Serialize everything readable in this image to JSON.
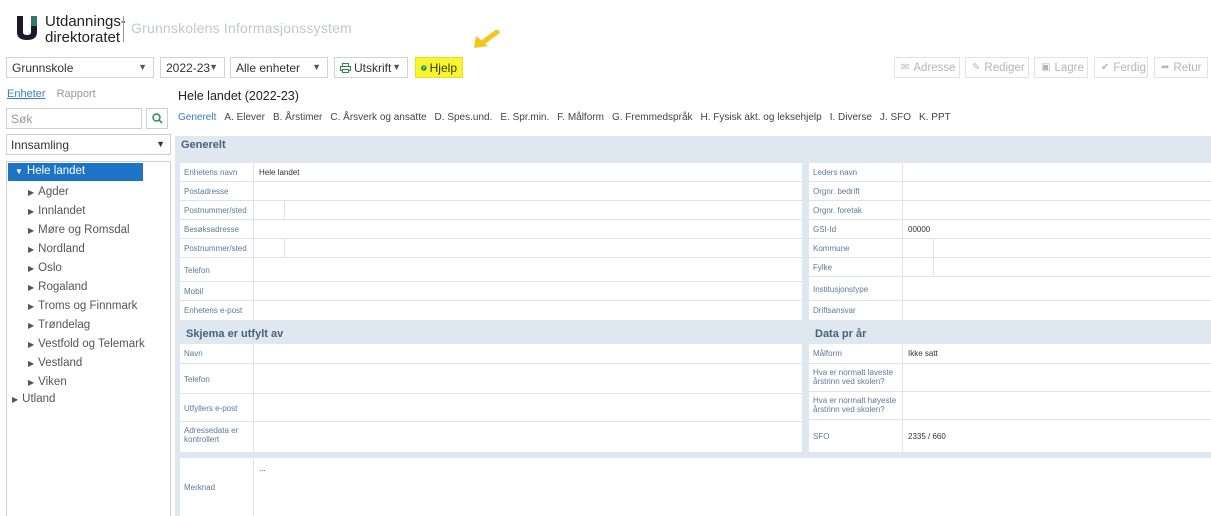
{
  "header": {
    "logo_line1": "Utdannings-",
    "logo_line2": "direktoratet",
    "system_name": "Grunnskolens Informasjonssystem"
  },
  "toolbar": {
    "school_type": "Grunnskole",
    "year": "2022-23",
    "unit_filter": "Alle enheter",
    "print_label": "Utskrift",
    "help_label": "Hjelp",
    "right_buttons": [
      "Adresse",
      "Rediger",
      "Lagre",
      "Ferdig",
      "Retur"
    ]
  },
  "sidebar": {
    "tabs": [
      "Enheter",
      "Rapport"
    ],
    "search_placeholder": "Søk",
    "collection_select": "Innsamling",
    "tree_selected": "Hele landet",
    "tree_items": [
      "Agder",
      "Innlandet",
      "Møre og Romsdal",
      "Nordland",
      "Oslo",
      "Rogaland",
      "Troms og Finnmark",
      "Trøndelag",
      "Vestfold og Telemark",
      "Vestland",
      "Viken"
    ],
    "tree_root_other": "Utland"
  },
  "main": {
    "title": "Hele landet (2022-23)",
    "tabs": [
      "Generelt",
      "A. Elever",
      "B. Årstimer",
      "C. Årsverk og ansatte",
      "D. Spes.und.",
      "E. Spr.min.",
      "F. Målform",
      "G. Fremmedspråk",
      "H. Fysisk akt. og leksehjelp",
      "I. Diverse",
      "J. SFO",
      "K. PPT"
    ],
    "section_title": "Generelt",
    "left_fields": [
      {
        "label": "Enhetens navn",
        "value": "Hele landet"
      },
      {
        "label": "Postadresse",
        "value": ""
      },
      {
        "label": "Postnummer/sted",
        "value": ""
      },
      {
        "label": "Besøksadresse",
        "value": ""
      },
      {
        "label": "Postnummer/sted",
        "value": ""
      },
      {
        "label": "Telefon",
        "value": ""
      },
      {
        "label": "Mobil",
        "value": ""
      },
      {
        "label": "Enhetens e-post",
        "value": ""
      }
    ],
    "right_fields": [
      {
        "label": "Leders navn",
        "value": ""
      },
      {
        "label": "Orgnr. bedrift",
        "value": ""
      },
      {
        "label": "Orgnr. foretak",
        "value": ""
      },
      {
        "label": "GSI-Id",
        "value": "00000"
      },
      {
        "label": "Kommune",
        "value": ""
      },
      {
        "label": "Fylke",
        "value": ""
      },
      {
        "label": "Institusjonstype",
        "value": ""
      },
      {
        "label": "Driftsansvar",
        "value": ""
      }
    ],
    "filled_by_title": "Skjema er utfylt av",
    "filled_by_fields": [
      {
        "label": "Navn",
        "value": ""
      },
      {
        "label": "Telefon",
        "value": ""
      },
      {
        "label": "Utfyllers e-post",
        "value": ""
      },
      {
        "label": "Adressedata er kontrollert",
        "value": ""
      }
    ],
    "data_year_title": "Data pr år",
    "data_year_fields": [
      {
        "label": "Målform",
        "value": "Ikke satt"
      },
      {
        "label": "Hva er normalt laveste årstrinn ved skolen?",
        "value": ""
      },
      {
        "label": "Hva er normalt høyeste årstrinn ved skolen?",
        "value": ""
      },
      {
        "label": "SFO",
        "value": "2335 / 660"
      }
    ],
    "remark_label": "Merknad",
    "remark_value": "..."
  }
}
